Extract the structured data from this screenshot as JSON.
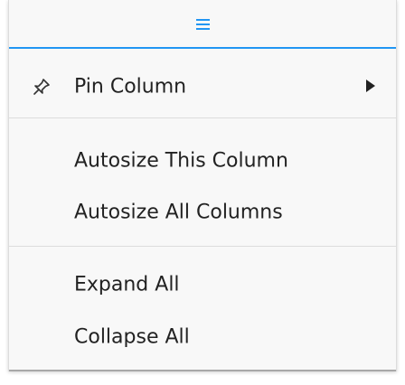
{
  "menu": {
    "icons": {
      "tab": "hamburger-menu-icon",
      "pin": "pin-icon",
      "submenu": "triangle-right-icon"
    },
    "accent_color": "#2196f3",
    "items": [
      {
        "label": "Pin Column"
      },
      {
        "label": "Autosize This Column"
      },
      {
        "label": "Autosize All Columns"
      },
      {
        "label": "Expand All"
      },
      {
        "label": "Collapse All"
      }
    ]
  }
}
